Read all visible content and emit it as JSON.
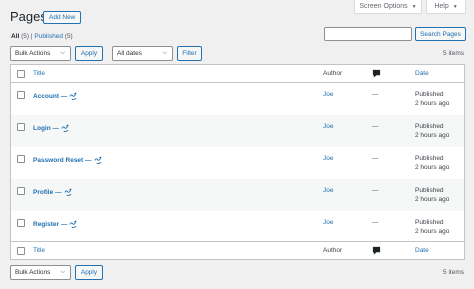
{
  "screen_options": {
    "label": "Screen Options"
  },
  "help": {
    "label": "Help"
  },
  "header": {
    "title": "Pages",
    "add_new": "Add New"
  },
  "filters": {
    "all_label": "All",
    "all_count": "(5)",
    "separator": "|",
    "published_label": "Published",
    "published_count": "(5)"
  },
  "search": {
    "value": "",
    "button": "Search Pages"
  },
  "top_nav": {
    "bulk_actions": "Bulk Actions",
    "apply": "Apply",
    "dates": "All dates",
    "filter": "Filter",
    "items": "5 items"
  },
  "table": {
    "headers": {
      "title": "Title",
      "author": "Author",
      "date": "Date"
    },
    "rows": [
      {
        "title": "Account —",
        "author": "Joe",
        "comments": "—",
        "status": "Published",
        "time": "2 hours ago"
      },
      {
        "title": "Login —",
        "author": "Joe",
        "comments": "—",
        "status": "Published",
        "time": "2 hours ago"
      },
      {
        "title": "Password Reset —",
        "author": "Joe",
        "comments": "—",
        "status": "Published",
        "time": "2 hours ago"
      },
      {
        "title": "Profile —",
        "author": "Joe",
        "comments": "—",
        "status": "Published",
        "time": "2 hours ago"
      },
      {
        "title": "Register —",
        "author": "Joe",
        "comments": "—",
        "status": "Published",
        "time": "2 hours ago"
      }
    ],
    "row_icon": "ultimate-member-icon",
    "comment_icon": "comment-bubble-icon"
  },
  "bottom_nav": {
    "bulk_actions": "Bulk Actions",
    "apply": "Apply",
    "items": "5 items"
  },
  "colors": {
    "link": "#2271b1",
    "background": "#f0f0f1",
    "border": "#c3c4c7"
  }
}
